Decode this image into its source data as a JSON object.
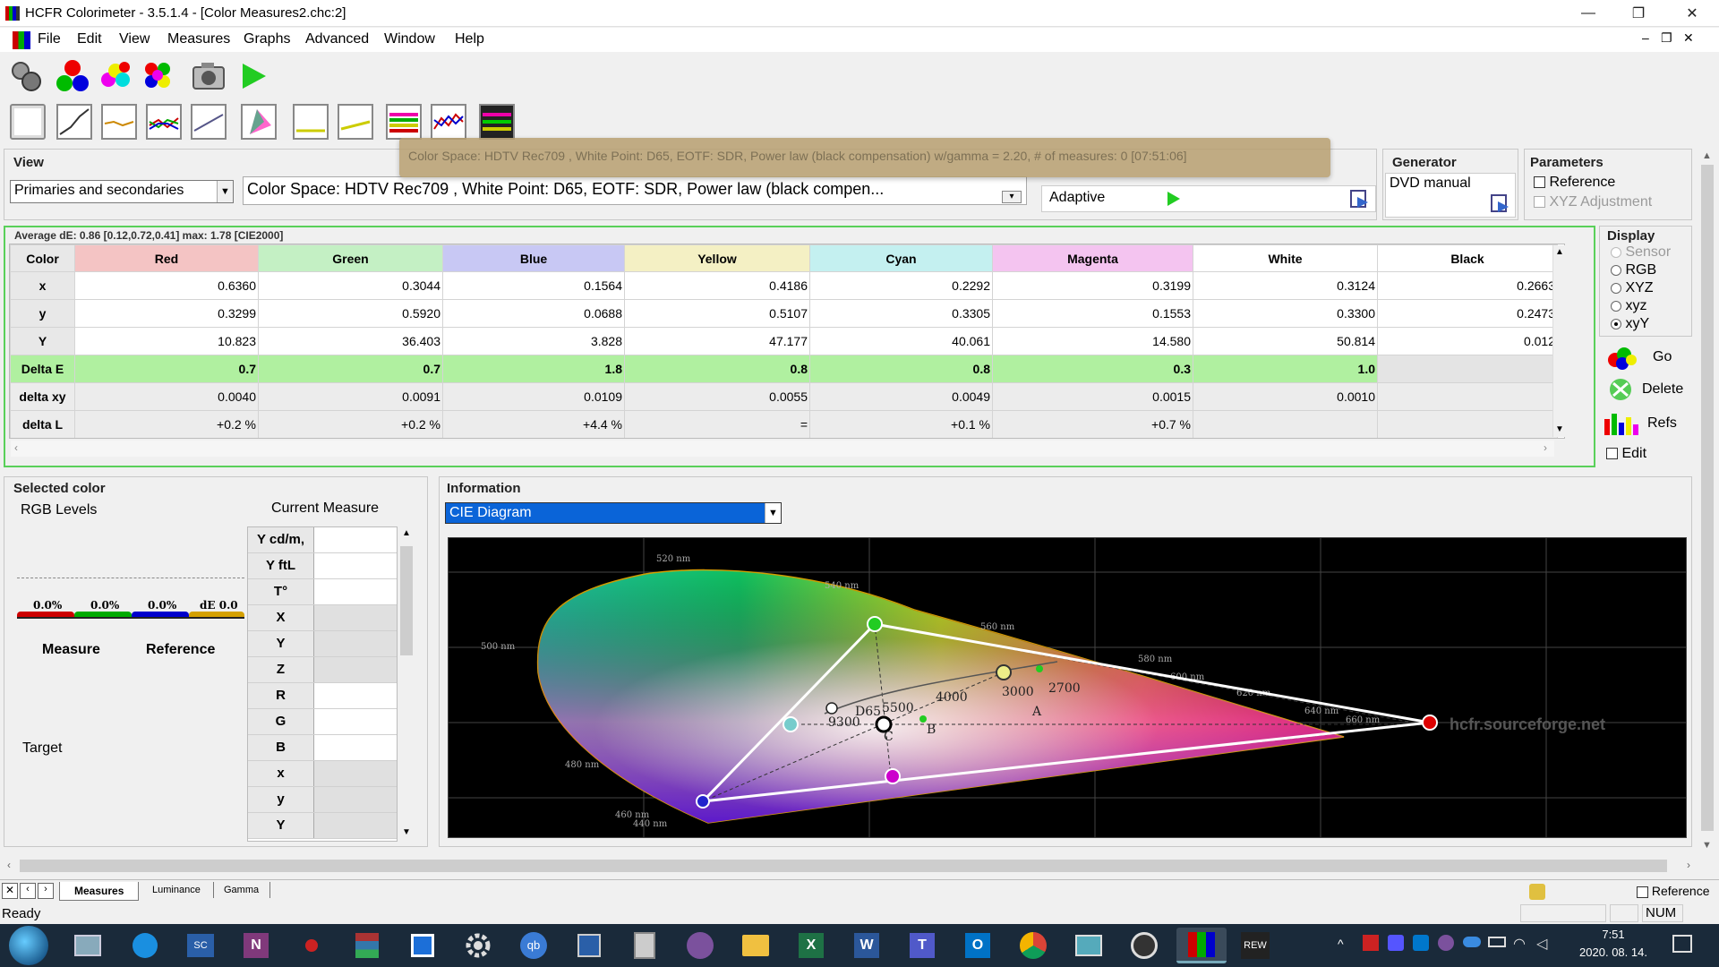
{
  "window": {
    "title": "HCFR Colorimeter - 3.5.1.4 - [Color Measures2.chc:2]",
    "minimize": "—",
    "restore": "❐",
    "close": "✕"
  },
  "menu": [
    "File",
    "Edit",
    "View",
    "Measures",
    "Graphs",
    "Advanced",
    "Window",
    "Help"
  ],
  "mdi_controls": [
    "–",
    "❐",
    "✕"
  ],
  "tooltip": "Color Space: HDTV Rec709 , White Point: D65, EOTF: SDR, Power law (black compensation) w/gamma = 2.20, # of measures: 0 [07:51:06]",
  "view": {
    "title": "View",
    "combo": "Primaries and secondaries",
    "colorspace": "Color Space: HDTV Rec709 , White Point: D65, EOTF: SDR, Power law (black compen...",
    "adaptive": "Adaptive"
  },
  "generator": {
    "title": "Generator",
    "value": "DVD manual"
  },
  "parameters": {
    "title": "Parameters",
    "reference": "Reference",
    "xyz_adjustment": "XYZ Adjustment"
  },
  "summary": "Average dE: 0.86 [0.12,0.72,0.41] max: 1.78 [CIE2000]",
  "grid": {
    "columns": [
      {
        "name": "Color",
        "color": "#e8e8e8"
      },
      {
        "name": "Red",
        "color": "#f4c4c4"
      },
      {
        "name": "Green",
        "color": "#c4f0c4"
      },
      {
        "name": "Blue",
        "color": "#c8c8f4"
      },
      {
        "name": "Yellow",
        "color": "#f4f0c4"
      },
      {
        "name": "Cyan",
        "color": "#c4f0f0"
      },
      {
        "name": "Magenta",
        "color": "#f4c4f0"
      },
      {
        "name": "White",
        "color": "#ffffff"
      },
      {
        "name": "Black",
        "color": "#ffffff"
      }
    ],
    "rows": [
      {
        "label": "x",
        "values": [
          "0.6360",
          "0.3044",
          "0.1564",
          "0.4186",
          "0.2292",
          "0.3199",
          "0.3124",
          "0.2663"
        ]
      },
      {
        "label": "y",
        "values": [
          "0.3299",
          "0.5920",
          "0.0688",
          "0.5107",
          "0.3305",
          "0.1553",
          "0.3300",
          "0.2473"
        ]
      },
      {
        "label": "Y",
        "values": [
          "10.823",
          "36.403",
          "3.828",
          "47.177",
          "40.061",
          "14.580",
          "50.814",
          "0.012"
        ]
      },
      {
        "label": "Delta E",
        "values": [
          "0.7",
          "0.7",
          "1.8",
          "0.8",
          "0.8",
          "0.3",
          "1.0",
          ""
        ]
      },
      {
        "label": "delta xy",
        "values": [
          "0.0040",
          "0.0091",
          "0.0109",
          "0.0055",
          "0.0049",
          "0.0015",
          "0.0010",
          ""
        ]
      },
      {
        "label": "delta L",
        "values": [
          "+0.2 %",
          "+0.2 %",
          "+4.4 %",
          "=",
          "+0.1 %",
          "+0.7 %",
          "",
          ""
        ]
      }
    ]
  },
  "display": {
    "title": "Display",
    "options": [
      "Sensor",
      "RGB",
      "XYZ",
      "xyz",
      "xyY"
    ],
    "selected": "xyY",
    "go": "Go",
    "delete": "Delete",
    "refs": "Refs",
    "edit": "Edit"
  },
  "selected_color": {
    "title": "Selected color",
    "rgb_levels": "RGB Levels",
    "current_measure": "Current Measure",
    "levels": [
      {
        "label": "0.0%",
        "color": "#cc0000"
      },
      {
        "label": "0.0%",
        "color": "#00aa00"
      },
      {
        "label": "0.0%",
        "color": "#0000cc"
      },
      {
        "label": "dE 0.0",
        "color": "#d4a000"
      }
    ],
    "measure": "Measure",
    "reference": "Reference",
    "target": "Target",
    "measure_rows": [
      "Y cd/m,",
      "Y ftL",
      "T°",
      "X",
      "Y",
      "Z",
      "R",
      "G",
      "B",
      "x",
      "y",
      "Y"
    ]
  },
  "information": {
    "title": "Information",
    "combo": "CIE Diagram",
    "watermark": "hcfr.sourceforge.net",
    "wavelengths": [
      "520 nm",
      "540 nm",
      "560 nm",
      "580 nm",
      "600 nm",
      "620 nm",
      "640 nm",
      "660 nm",
      "500 nm",
      "480 nm",
      "460 nm",
      "440 nm"
    ],
    "cct_labels": [
      "9300",
      "D65",
      "5500",
      "4000",
      "3000",
      "2700",
      "A",
      "B",
      "C"
    ]
  },
  "tabs": [
    "Measures",
    "Luminance",
    "Gamma"
  ],
  "status": {
    "text": "Ready",
    "num": "NUM",
    "reference": "Reference"
  },
  "clock": {
    "time": "7:51",
    "date": "2020. 08. 14."
  }
}
